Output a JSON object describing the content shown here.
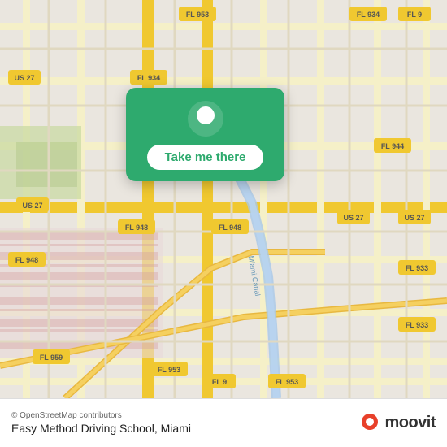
{
  "map": {
    "background_color": "#e8e0d8",
    "osm_credit": "© OpenStreetMap contributors",
    "location_label": "Easy Method Driving School, Miami"
  },
  "popup": {
    "button_label": "Take me there"
  },
  "moovit": {
    "logo_text": "moovit"
  },
  "road_labels": [
    "FL 9",
    "FL 934",
    "FL 953",
    "FL 953",
    "FL 9",
    "US 27",
    "US 27",
    "FL 944",
    "FL 948",
    "FL 948",
    "FL 933",
    "FL 933",
    "FL 959",
    "US 27",
    "Miami Canal"
  ]
}
